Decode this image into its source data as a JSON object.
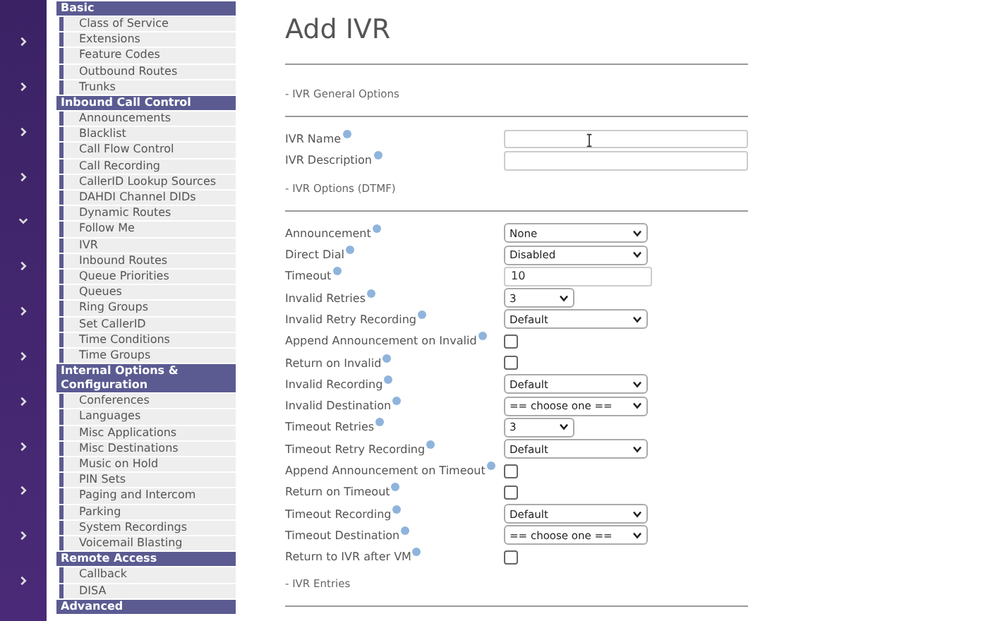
{
  "rail": [
    {
      "expanded": false
    },
    {
      "expanded": false
    },
    {
      "expanded": false
    },
    {
      "expanded": false
    },
    {
      "expanded": true
    },
    {
      "expanded": false
    },
    {
      "expanded": false
    },
    {
      "expanded": false
    },
    {
      "expanded": false
    },
    {
      "expanded": false
    },
    {
      "expanded": false
    },
    {
      "expanded": false
    },
    {
      "expanded": false
    }
  ],
  "nav": [
    {
      "title": "Basic",
      "items": [
        "Class of Service",
        "Extensions",
        "Feature Codes",
        "Outbound Routes",
        "Trunks"
      ]
    },
    {
      "title": "Inbound Call Control",
      "items": [
        "Announcements",
        "Blacklist",
        "Call Flow Control",
        "Call Recording",
        "CallerID Lookup Sources",
        "DAHDI Channel DIDs",
        "Dynamic Routes",
        "Follow Me",
        "IVR",
        "Inbound Routes",
        "Queue Priorities",
        "Queues",
        "Ring Groups",
        "Set CallerID",
        "Time Conditions",
        "Time Groups"
      ]
    },
    {
      "title": "Internal Options & Configuration",
      "items": [
        "Conferences",
        "Languages",
        "Misc Applications",
        "Misc Destinations",
        "Music on Hold",
        "PIN Sets",
        "Paging and Intercom",
        "Parking",
        "System Recordings",
        "Voicemail Blasting"
      ]
    },
    {
      "title": "Remote Access",
      "items": [
        "Callback",
        "DISA"
      ]
    },
    {
      "title": "Advanced"
    }
  ],
  "title": "Add IVR",
  "sections": [
    {
      "heading": "- IVR General Options",
      "fields": [
        {
          "label": "IVR Name",
          "kind": "input"
        },
        {
          "label": "IVR Description",
          "kind": "input"
        }
      ]
    },
    {
      "heading": "- IVR Options (DTMF)",
      "fields": [
        {
          "label": "Announcement",
          "kind": "wideselect",
          "value": "None"
        },
        {
          "label": "Direct Dial",
          "kind": "select",
          "value": "Disabled"
        },
        {
          "label": "Timeout",
          "kind": "shortinput",
          "value": "10"
        },
        {
          "label": "Invalid Retries",
          "kind": "smallselect",
          "value": "3"
        },
        {
          "label": "Invalid Retry Recording",
          "kind": "wideselect",
          "value": "Default"
        },
        {
          "label": "Append Announcement on Invalid",
          "kind": "checkbox",
          "checked": false
        },
        {
          "label": "Return on Invalid",
          "kind": "checkbox",
          "checked": false
        },
        {
          "label": "Invalid Recording",
          "kind": "wideselect",
          "value": "Default"
        },
        {
          "label": "Invalid Destination",
          "kind": "select",
          "value": "== choose one =="
        },
        {
          "label": "Timeout Retries",
          "kind": "smallselect",
          "value": "3"
        },
        {
          "label": "Timeout Retry Recording",
          "kind": "wideselect",
          "value": "Default"
        },
        {
          "label": "Append Announcement on Timeout",
          "kind": "checkbox",
          "checked": false
        },
        {
          "label": "Return on Timeout",
          "kind": "checkbox",
          "checked": false
        },
        {
          "label": "Timeout Recording",
          "kind": "wideselect",
          "value": "Default"
        },
        {
          "label": "Timeout Destination",
          "kind": "select",
          "value": "== choose one =="
        },
        {
          "label": "Return to IVR after VM",
          "kind": "checkbox",
          "checked": false
        }
      ]
    },
    {
      "heading": "- IVR Entries"
    }
  ]
}
